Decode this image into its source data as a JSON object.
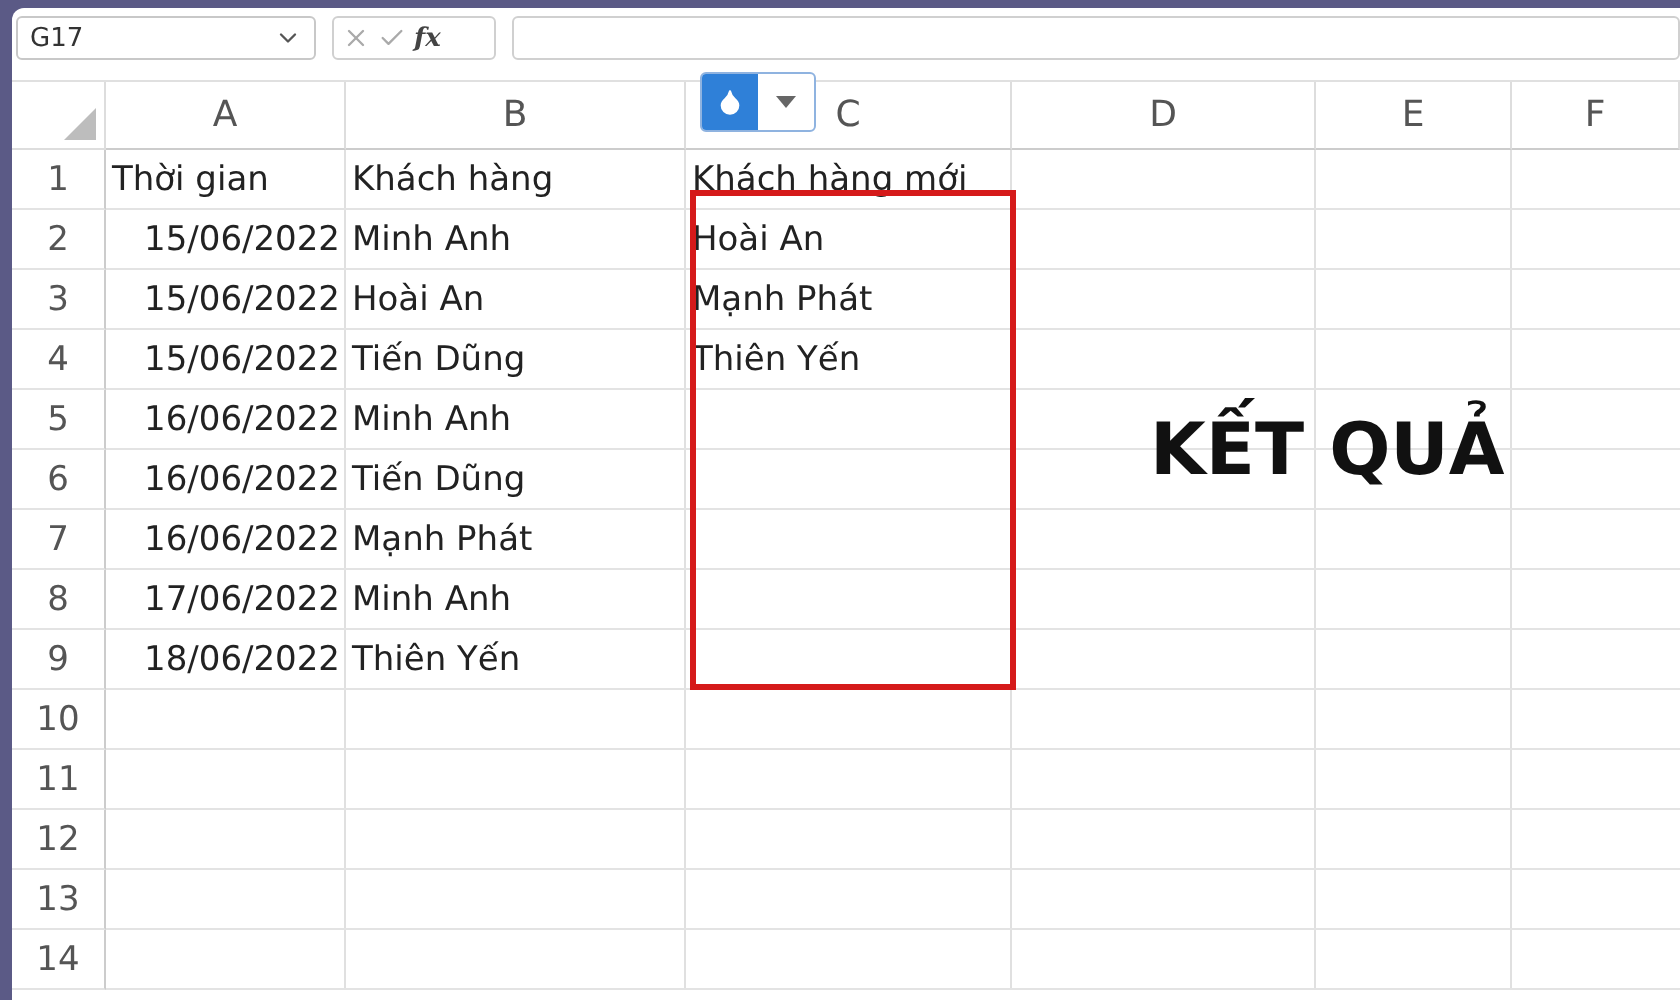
{
  "name_box": "G17",
  "formula_bar": {
    "function_label": "fx"
  },
  "columns": [
    "A",
    "B",
    "C",
    "D",
    "E",
    "F"
  ],
  "rows": [
    {
      "number": "1",
      "cells": [
        {
          "text": "Thời gian",
          "kind": "text"
        },
        {
          "text": "Khách hàng",
          "kind": "text"
        },
        {
          "text": "Khách hàng mới",
          "kind": "text"
        }
      ]
    },
    {
      "number": "2",
      "cells": [
        {
          "text": "15/06/2022",
          "kind": "date"
        },
        {
          "text": "Minh Anh",
          "kind": "text"
        },
        {
          "text": "Hoài An",
          "kind": "text"
        }
      ]
    },
    {
      "number": "3",
      "cells": [
        {
          "text": "15/06/2022",
          "kind": "date"
        },
        {
          "text": "Hoài An",
          "kind": "text"
        },
        {
          "text": "Mạnh Phát",
          "kind": "text"
        }
      ]
    },
    {
      "number": "4",
      "cells": [
        {
          "text": "15/06/2022",
          "kind": "date"
        },
        {
          "text": "Tiến Dũng",
          "kind": "text"
        },
        {
          "text": "Thiên Yến",
          "kind": "text"
        }
      ]
    },
    {
      "number": "5",
      "cells": [
        {
          "text": "16/06/2022",
          "kind": "date"
        },
        {
          "text": "Minh Anh",
          "kind": "text"
        }
      ]
    },
    {
      "number": "6",
      "cells": [
        {
          "text": "16/06/2022",
          "kind": "date"
        },
        {
          "text": "Tiến Dũng",
          "kind": "text"
        }
      ]
    },
    {
      "number": "7",
      "cells": [
        {
          "text": "16/06/2022",
          "kind": "date"
        },
        {
          "text": "Mạnh Phát",
          "kind": "text"
        }
      ]
    },
    {
      "number": "8",
      "cells": [
        {
          "text": "17/06/2022",
          "kind": "date"
        },
        {
          "text": "Minh Anh",
          "kind": "text"
        }
      ]
    },
    {
      "number": "9",
      "cells": [
        {
          "text": "18/06/2022",
          "kind": "date"
        },
        {
          "text": "Thiên Yến",
          "kind": "text"
        }
      ]
    },
    {
      "number": "10",
      "cells": []
    },
    {
      "number": "11",
      "cells": []
    },
    {
      "number": "12",
      "cells": []
    },
    {
      "number": "13",
      "cells": []
    },
    {
      "number": "14",
      "cells": []
    }
  ],
  "annotation": {
    "label": "KẾT QUẢ"
  }
}
